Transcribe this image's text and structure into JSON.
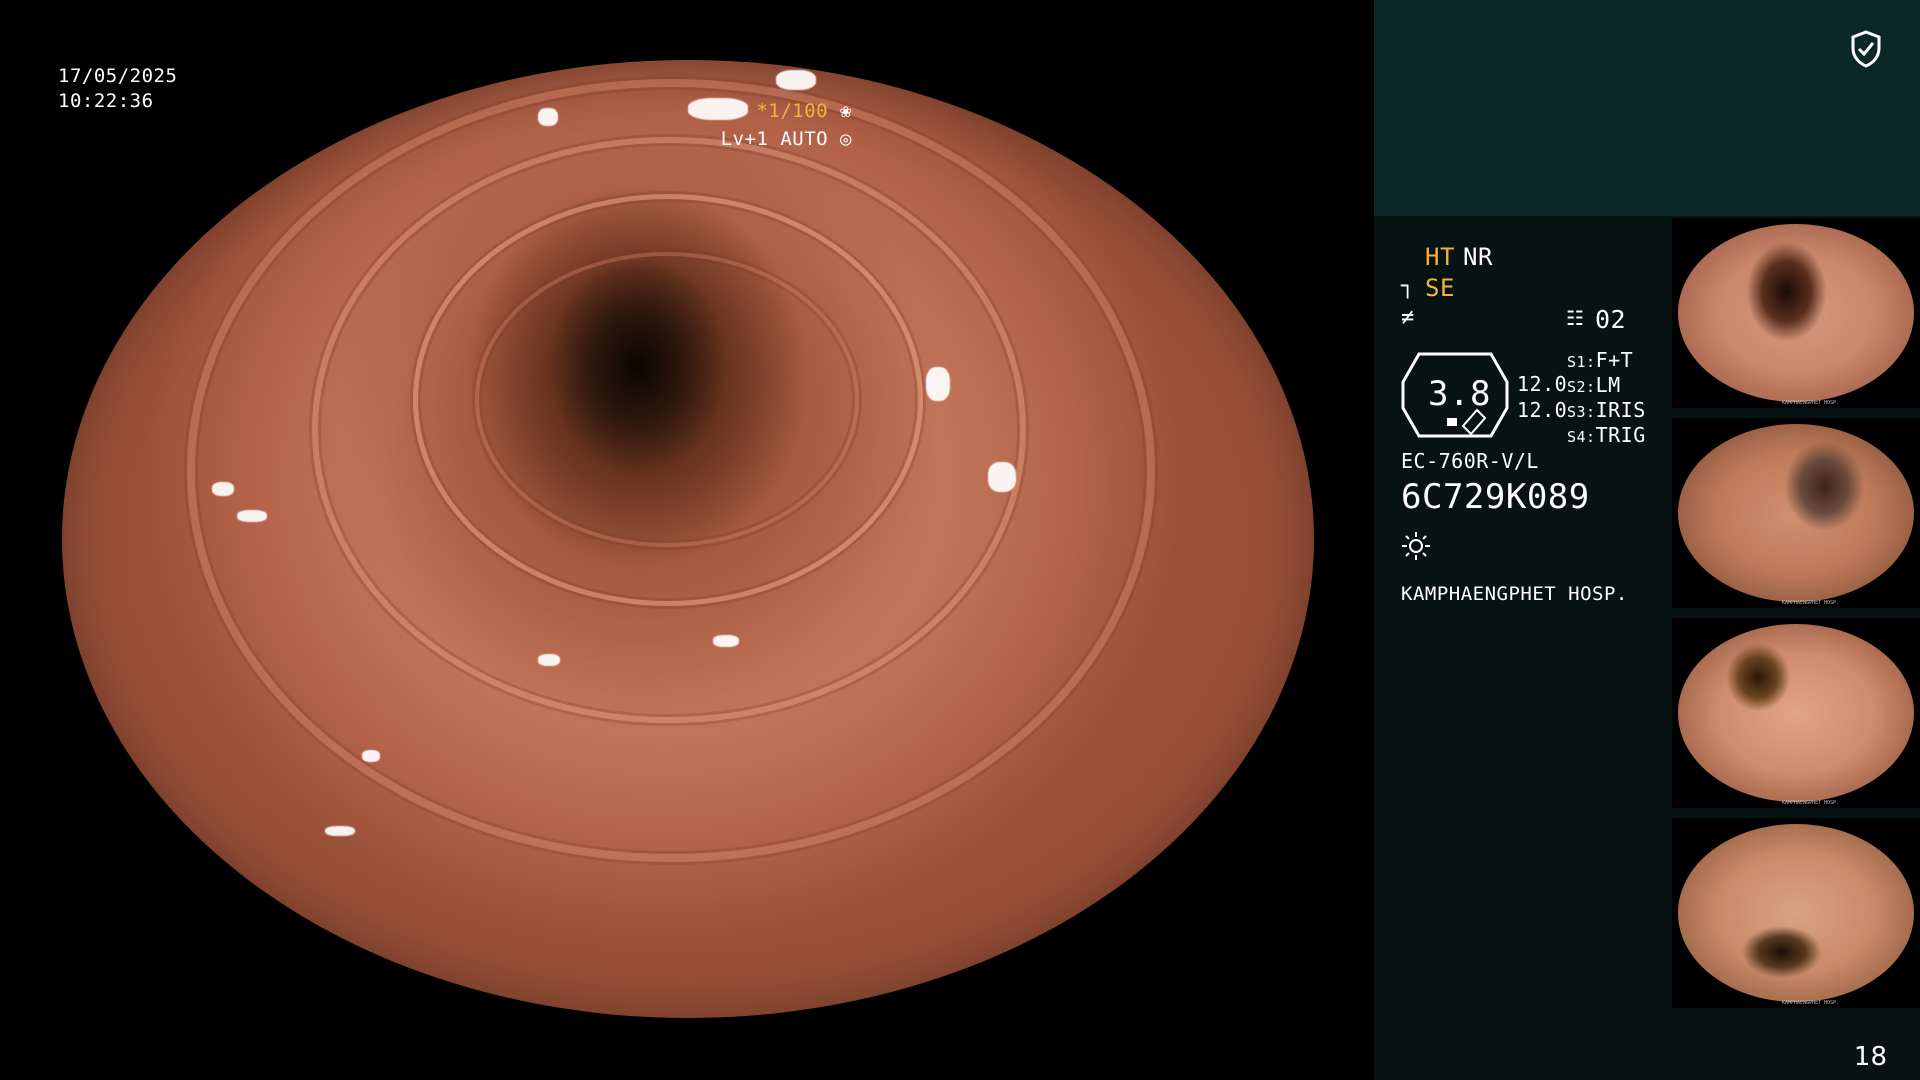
{
  "overlay": {
    "date": "17/05/2025",
    "time": "10:22:36",
    "shutter": "*1/100",
    "level": "Lv+1 AUTO"
  },
  "status": {
    "ht": "HT",
    "nr": "NR",
    "se": "SE",
    "memory": "02",
    "gauge_value": "3.8",
    "pressure_1": "12.0",
    "pressure_2": "12.0",
    "s1": "S1:",
    "s1_val": "F+T",
    "s2": "S2:",
    "s2_val": "LM",
    "s3": "S3:",
    "s3_val": "IRIS",
    "s4": "S4:",
    "s4_val": "TRIG",
    "scope_model": "EC-760R-V/L",
    "serial": "6C729K089",
    "hospital": "KAMPHAENGPHET HOSP."
  },
  "thumbnails": [
    {
      "id": "1",
      "caption": "KAMPHAENGPHET HOSP."
    },
    {
      "id": "2",
      "caption": "KAMPHAENGPHET HOSP."
    },
    {
      "id": "3",
      "caption": "KAMPHAENGPHET HOSP."
    },
    {
      "id": "4",
      "caption": "KAMPHAENGPHET HOSP."
    }
  ],
  "page": {
    "number": "18"
  },
  "colors": {
    "accent_amber": "#f4b23c",
    "panel_top": "#0b2828",
    "panel_bottom": "#061312"
  },
  "icons": [
    "shield-check-icon",
    "shutter-icon",
    "iris-icon",
    "scope-icon",
    "memory-icon",
    "light-icon"
  ]
}
